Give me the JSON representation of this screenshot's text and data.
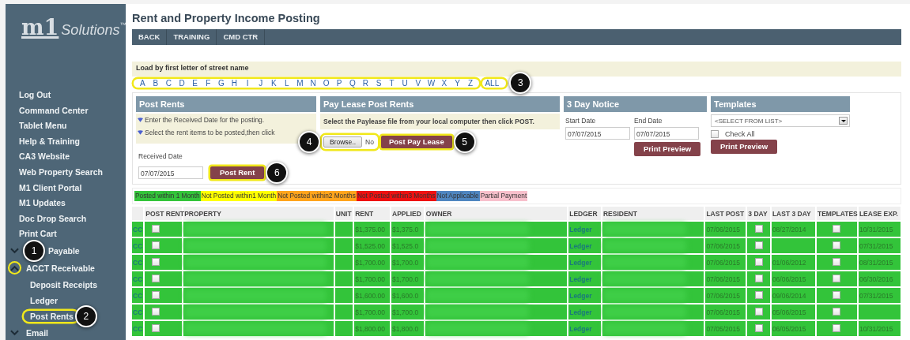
{
  "sidebar": {
    "logo": {
      "mark": "m1",
      "word": "Solutions",
      "trademark": "™"
    },
    "items": [
      {
        "label": "Log Out",
        "kind": "link"
      },
      {
        "label": "Command Center",
        "kind": "link"
      },
      {
        "label": "Tablet Menu",
        "kind": "link"
      },
      {
        "label": "Help & Training",
        "kind": "link"
      },
      {
        "label": "CA3 Website",
        "kind": "link"
      },
      {
        "label": "Web Property Search",
        "kind": "link"
      },
      {
        "label": "M1 Client Portal",
        "kind": "link"
      },
      {
        "label": "M1 Updates",
        "kind": "link"
      },
      {
        "label": "Doc Drop Search",
        "kind": "link"
      },
      {
        "label": "Print Cart",
        "kind": "link"
      },
      {
        "label": "Payable",
        "kind": "group",
        "expanded": false,
        "highlighted": false,
        "callout": "1"
      },
      {
        "label": "ACCT Receivable",
        "kind": "group",
        "expanded": true,
        "highlighted": true,
        "children": [
          {
            "label": "Deposit Receipts",
            "highlighted": false
          },
          {
            "label": "Ledger",
            "highlighted": false
          },
          {
            "label": "Post Rents",
            "highlighted": true,
            "callout": "2"
          }
        ]
      },
      {
        "label": "Email",
        "kind": "group",
        "expanded": false,
        "highlighted": false
      }
    ]
  },
  "page": {
    "title": "Rent and Property Income Posting",
    "nav": [
      "BACK",
      "TRAINING",
      "CMD CTR"
    ]
  },
  "letters": {
    "caption": "Load by first letter of street name",
    "items": [
      "A",
      "B",
      "C",
      "D",
      "E",
      "F",
      "G",
      "H",
      "I",
      "J",
      "K",
      "L",
      "M",
      "N",
      "O",
      "P",
      "Q",
      "R",
      "S",
      "T",
      "U",
      "V",
      "W",
      "X",
      "Y",
      "Z"
    ],
    "all": "ALL",
    "highlighted": true,
    "callout": "3"
  },
  "post_rents": {
    "header": "Post Rents",
    "steps": [
      "Enter the Received Date for the posting.",
      "Select the rent items to be posted,then click"
    ],
    "date_label": "Received Date",
    "date_value": "07/07/2015",
    "button": {
      "label": "Post Rent",
      "highlighted": true,
      "callout": "6"
    }
  },
  "pay_lease": {
    "header": "Pay Lease Post Rents",
    "text": "Select the Paylease file from your local computer then click POST.",
    "file": {
      "button": "Browse..",
      "status": "No",
      "highlighted": true,
      "callout": "4"
    },
    "button": {
      "label": "Post Pay Lease",
      "highlighted": true,
      "callout": "5"
    }
  },
  "three_day": {
    "header": "3 Day Notice",
    "start_label": "Start Date",
    "end_label": "End Date",
    "start_value": "07/07/2015",
    "end_value": "07/07/2015",
    "button": "Print Preview"
  },
  "templates": {
    "header": "Templates",
    "select": "<SELECT FROM LIST>",
    "check_all": {
      "label": "Check All",
      "checked": false
    },
    "button": "Print Preview"
  },
  "legend": [
    {
      "label": "Posted within 1 Month",
      "color": "#33c43a"
    },
    {
      "label": "Not Posted within1 Month",
      "color": "#ffff00"
    },
    {
      "label": "Not Posted within2 Months",
      "color": "#ffa41c"
    },
    {
      "label": "Not Posted within3 Months",
      "color": "#ee1111"
    },
    {
      "label": "Not Applicable",
      "color": "#4f86c0"
    },
    {
      "label": "Partial Payment",
      "color": "#f8c0cc"
    }
  ],
  "table": {
    "columns": [
      "",
      "POST RENT",
      "PROPERTY",
      "UNIT",
      "RENT",
      "APPLIED",
      "OWNER",
      "LEDGER",
      "RESIDENT",
      "LAST POST",
      "3 DAY",
      "LAST 3 DAY",
      "TEMPLATES",
      "LEASE EXP."
    ],
    "rows": [
      {
        "code": "CC",
        "post": false,
        "rent": "$1,375.00",
        "applied": "$1,375.0",
        "ledger": "Ledger",
        "last_post": "07/06/2015",
        "three_day": false,
        "last_three_day": "08/27/2014",
        "template": false,
        "lease_exp": "10/31/2015",
        "color": "#33c43a"
      },
      {
        "code": "CC",
        "post": false,
        "rent": "$1,525.00",
        "applied": "$1,525.0",
        "ledger": "Ledger",
        "last_post": "07/06/2015",
        "three_day": false,
        "last_three_day": "",
        "template": false,
        "lease_exp": "07/31/2015",
        "color": "#33c43a"
      },
      {
        "code": "CC",
        "post": false,
        "rent": "$1,700.00",
        "applied": "$1,700.0",
        "ledger": "Ledger",
        "last_post": "07/06/2015",
        "three_day": false,
        "last_three_day": "01/06/2012",
        "template": false,
        "lease_exp": "08/31/2015",
        "color": "#33c43a"
      },
      {
        "code": "CC",
        "post": false,
        "rent": "$1,700.00",
        "applied": "$1,700.0",
        "ledger": "Ledger",
        "last_post": "07/06/2015",
        "three_day": false,
        "last_three_day": "06/06/2015",
        "template": false,
        "lease_exp": "06/30/2016",
        "color": "#33c43a"
      },
      {
        "code": "CC",
        "post": false,
        "rent": "$1,600.00",
        "applied": "$1,600.0",
        "ledger": "Ledger",
        "last_post": "07/06/2015",
        "three_day": false,
        "last_three_day": "09/06/2014",
        "template": false,
        "lease_exp": "07/31/2015",
        "color": "#33c43a"
      },
      {
        "code": "CC",
        "post": false,
        "rent": "$1,700.00",
        "applied": "$1,700.0",
        "ledger": "Ledger",
        "last_post": "07/06/2015",
        "three_day": false,
        "last_three_day": "05/06/2015",
        "template": false,
        "lease_exp": "",
        "color": "#33c43a"
      },
      {
        "code": "CC",
        "post": false,
        "rent": "$1,800.00",
        "applied": "$1,800.0",
        "ledger": "Ledger",
        "last_post": "07/05/2015",
        "three_day": false,
        "last_three_day": "06/05/2015",
        "template": false,
        "lease_exp": "10/31/2015",
        "color": "#33c43a"
      }
    ]
  }
}
